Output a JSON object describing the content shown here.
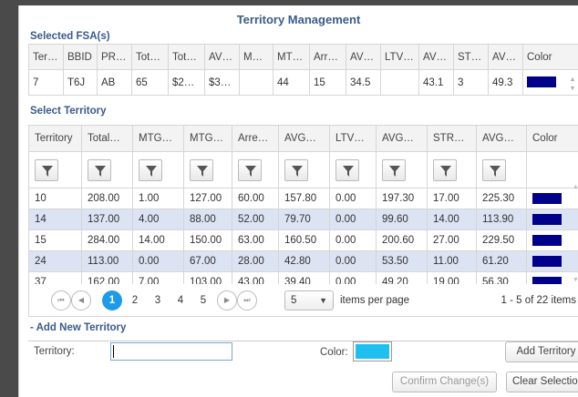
{
  "dialog": {
    "title": "Territory Management"
  },
  "fsa": {
    "section_title": "Selected FSA(s)",
    "columns": [
      "Territor",
      "BBID",
      "PROV",
      "Total_I",
      "Total_I",
      "AVG_I",
      "MTG_",
      "MTG_",
      "Arrear",
      "AVG_L",
      "LTV_C",
      "AVG_I",
      "STRES",
      "AVG_L",
      "Color"
    ],
    "row": [
      "7",
      "T6J",
      "AB",
      "65",
      "$2…",
      "$3…",
      "",
      "44",
      "15",
      "34.5",
      "",
      "43.1",
      "3",
      "49.3"
    ],
    "row_color": "#00008b"
  },
  "territory": {
    "section_title": "Select Territory",
    "columns": [
      "Territory",
      "Total…",
      "MTG…",
      "MTG…",
      "Arrea…",
      "AVG…",
      "LTV_…",
      "AVG…",
      "STR…",
      "AVG…",
      "Color"
    ],
    "rows": [
      [
        "10",
        "208.00",
        "1.00",
        "127.00",
        "60.00",
        "157.80",
        "0.00",
        "197.30",
        "17.00",
        "225.30"
      ],
      [
        "14",
        "137.00",
        "4.00",
        "88.00",
        "52.00",
        "79.70",
        "0.00",
        "99.60",
        "14.00",
        "113.90"
      ],
      [
        "15",
        "284.00",
        "14.00",
        "150.00",
        "63.00",
        "160.50",
        "0.00",
        "200.60",
        "27.00",
        "229.50"
      ],
      [
        "24",
        "113.00",
        "0.00",
        "67.00",
        "28.00",
        "42.80",
        "0.00",
        "53.50",
        "11.00",
        "61.20"
      ],
      [
        "37",
        "162.00",
        "7.00",
        "103.00",
        "43.00",
        "39.40",
        "0.00",
        "49.20",
        "19.00",
        "56.30"
      ]
    ],
    "row_color": "#00008b",
    "highlight_color": "#dce3f3"
  },
  "pager": {
    "pages": [
      "1",
      "2",
      "3",
      "4",
      "5"
    ],
    "current_page": "1",
    "page_size": "5",
    "per_page_label": "items per page",
    "info": "1 - 5 of 22 items"
  },
  "add_new": {
    "section_title": "- Add New Territory",
    "territory_label": "Territory:",
    "territory_value": "",
    "color_label": "Color:",
    "color_value": "#1fc0f0",
    "add_button": "Add Territory"
  },
  "footer": {
    "confirm_button": "Confirm Change(s)",
    "clear_button": "Clear Selection"
  }
}
